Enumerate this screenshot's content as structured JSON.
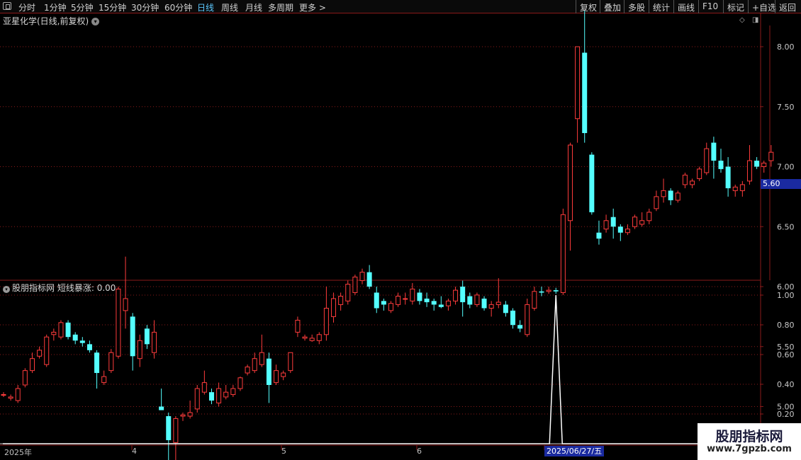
{
  "toolbar": {
    "periods": [
      "分时",
      "1分钟",
      "5分钟",
      "15分钟",
      "30分钟",
      "60分钟",
      "日线",
      "周线",
      "月线",
      "多周期",
      "更多 >"
    ],
    "active_period": "日线",
    "right_buttons": [
      "复权",
      "叠加",
      "多股",
      "统计",
      "画线",
      "F10",
      "标记",
      "+自选",
      "返回"
    ]
  },
  "chart_title": "亚星化学(日线,前复权)",
  "price_box": "5.60",
  "indicator": {
    "title": "股朋指标网",
    "label": "短线暴涨: 0.00"
  },
  "axis": {
    "price_ticks": [
      "8.00",
      "7.50",
      "7.00",
      "6.50",
      "6.00",
      "5.50",
      "5.00",
      "4.50"
    ],
    "indicator_ticks": [
      "1.00",
      "0.80",
      "0.60",
      "0.40",
      "0.20"
    ],
    "date_labels": [
      "2025年",
      "4",
      "5",
      "6"
    ],
    "cursor_date": "2025/06/27/五"
  },
  "watermark": {
    "title": "股朋指标网",
    "url": "www.7gpzb.com"
  },
  "colors": {
    "up": "#ff3c3c",
    "down": "#54ffff",
    "grid": "#8a1a1a",
    "price_box": "#1a2aa0"
  },
  "chart_data": {
    "type": "candlestick",
    "title": "亚星化学(日线,前复权)",
    "ylim": [
      4.3,
      8.4
    ],
    "candles": [
      [
        5.1,
        5.12,
        5.08,
        5.1
      ],
      [
        5.07,
        5.1,
        5.05,
        5.08
      ],
      [
        5.05,
        5.18,
        5.03,
        5.15
      ],
      [
        5.18,
        5.32,
        5.16,
        5.3
      ],
      [
        5.3,
        5.45,
        5.28,
        5.4
      ],
      [
        5.42,
        5.5,
        5.4,
        5.47
      ],
      [
        5.35,
        5.6,
        5.33,
        5.58
      ],
      [
        5.6,
        5.65,
        5.55,
        5.62
      ],
      [
        5.58,
        5.72,
        5.56,
        5.7
      ],
      [
        5.7,
        5.72,
        5.56,
        5.58
      ],
      [
        5.6,
        5.62,
        5.52,
        5.55
      ],
      [
        5.55,
        5.58,
        5.5,
        5.53
      ],
      [
        5.52,
        5.55,
        5.45,
        5.47
      ],
      [
        5.45,
        5.47,
        5.15,
        5.28
      ],
      [
        5.2,
        5.3,
        5.18,
        5.25
      ],
      [
        5.3,
        5.48,
        5.28,
        5.45
      ],
      [
        5.42,
        6.0,
        5.4,
        5.98
      ],
      [
        5.8,
        6.25,
        5.65,
        5.9
      ],
      [
        5.75,
        5.78,
        5.3,
        5.42
      ],
      [
        5.4,
        5.6,
        5.33,
        5.55
      ],
      [
        5.65,
        5.68,
        5.48,
        5.52
      ],
      [
        5.45,
        5.72,
        5.4,
        5.62
      ],
      [
        5.0,
        5.15,
        4.98,
        4.97
      ],
      [
        4.92,
        4.95,
        4.55,
        4.72
      ],
      [
        4.7,
        4.92,
        4.35,
        4.9
      ],
      [
        4.92,
        4.95,
        4.88,
        4.93
      ],
      [
        4.92,
        5.05,
        4.9,
        4.95
      ],
      [
        4.98,
        5.18,
        4.95,
        5.15
      ],
      [
        5.12,
        5.3,
        5.1,
        5.2
      ],
      [
        5.12,
        5.15,
        5.02,
        5.05
      ],
      [
        5.03,
        5.2,
        5.0,
        5.15
      ],
      [
        5.08,
        5.18,
        5.06,
        5.12
      ],
      [
        5.1,
        5.18,
        5.08,
        5.15
      ],
      [
        5.15,
        5.25,
        5.13,
        5.24
      ],
      [
        5.28,
        5.35,
        5.26,
        5.33
      ],
      [
        5.3,
        5.45,
        5.28,
        5.4
      ],
      [
        5.35,
        5.6,
        5.33,
        5.45
      ],
      [
        5.4,
        5.45,
        5.03,
        5.18
      ],
      [
        5.2,
        5.35,
        5.18,
        5.3
      ],
      [
        5.25,
        5.3,
        5.22,
        5.28
      ],
      [
        5.3,
        5.45,
        5.28,
        5.45
      ],
      [
        5.62,
        5.75,
        5.58,
        5.72
      ],
      [
        5.57,
        5.6,
        5.55,
        5.58
      ],
      [
        5.55,
        5.6,
        5.54,
        5.57
      ],
      [
        5.55,
        5.62,
        5.52,
        5.6
      ],
      [
        5.6,
        6.0,
        5.55,
        5.82
      ],
      [
        5.75,
        5.95,
        5.7,
        5.9
      ],
      [
        5.85,
        5.95,
        5.8,
        5.92
      ],
      [
        5.88,
        6.05,
        5.85,
        6.02
      ],
      [
        5.95,
        6.1,
        5.93,
        6.08
      ],
      [
        6.05,
        6.15,
        6.02,
        6.12
      ],
      [
        6.12,
        6.18,
        5.98,
        6.0
      ],
      [
        5.95,
        6.0,
        5.78,
        5.82
      ],
      [
        5.88,
        5.9,
        5.8,
        5.85
      ],
      [
        5.8,
        5.88,
        5.78,
        5.86
      ],
      [
        5.85,
        5.95,
        5.83,
        5.92
      ],
      [
        5.9,
        5.95,
        5.85,
        5.9
      ],
      [
        5.88,
        6.03,
        5.85,
        5.98
      ],
      [
        5.95,
        5.98,
        5.85,
        5.88
      ],
      [
        5.9,
        5.95,
        5.83,
        5.87
      ],
      [
        5.88,
        5.9,
        5.8,
        5.85
      ],
      [
        5.85,
        5.92,
        5.82,
        5.83
      ],
      [
        5.84,
        5.9,
        5.8,
        5.88
      ],
      [
        5.88,
        6.0,
        5.85,
        5.97
      ],
      [
        6.0,
        6.05,
        5.75,
        5.87
      ],
      [
        5.92,
        5.95,
        5.82,
        5.85
      ],
      [
        5.85,
        5.95,
        5.83,
        5.93
      ],
      [
        5.9,
        5.92,
        5.8,
        5.82
      ],
      [
        5.82,
        5.88,
        5.75,
        5.85
      ],
      [
        5.85,
        6.07,
        5.82,
        5.87
      ],
      [
        5.85,
        5.88,
        5.75,
        5.78
      ],
      [
        5.8,
        5.82,
        5.65,
        5.68
      ],
      [
        5.68,
        5.72,
        5.62,
        5.65
      ],
      [
        5.6,
        5.9,
        5.58,
        5.85
      ],
      [
        5.82,
        6.0,
        5.8,
        5.96
      ],
      [
        5.96,
        6.0,
        5.92,
        5.95
      ],
      [
        5.96,
        6.0,
        5.94,
        5.97
      ],
      [
        5.97,
        5.99,
        5.94,
        5.96
      ],
      [
        5.95,
        6.65,
        5.93,
        6.6
      ],
      [
        6.55,
        7.2,
        6.3,
        7.18
      ],
      [
        7.4,
        8.0,
        7.2,
        8.0
      ],
      [
        7.95,
        8.3,
        7.2,
        7.28
      ],
      [
        7.1,
        7.12,
        6.6,
        6.62
      ],
      [
        6.45,
        6.55,
        6.35,
        6.4
      ],
      [
        6.48,
        6.6,
        6.45,
        6.55
      ],
      [
        6.58,
        6.65,
        6.4,
        6.5
      ],
      [
        6.5,
        6.52,
        6.38,
        6.45
      ],
      [
        6.45,
        6.52,
        6.43,
        6.48
      ],
      [
        6.5,
        6.6,
        6.48,
        6.58
      ],
      [
        6.52,
        6.62,
        6.5,
        6.55
      ],
      [
        6.55,
        6.65,
        6.52,
        6.62
      ],
      [
        6.65,
        6.8,
        6.63,
        6.75
      ],
      [
        6.75,
        6.9,
        6.7,
        6.8
      ],
      [
        6.8,
        6.82,
        6.68,
        6.72
      ],
      [
        6.72,
        6.8,
        6.7,
        6.78
      ],
      [
        6.85,
        6.95,
        6.82,
        6.93
      ],
      [
        6.85,
        6.9,
        6.82,
        6.88
      ],
      [
        6.9,
        7.0,
        6.88,
        6.98
      ],
      [
        6.95,
        7.2,
        6.93,
        7.15
      ],
      [
        7.2,
        7.25,
        6.9,
        7.05
      ],
      [
        7.05,
        7.15,
        6.95,
        6.98
      ],
      [
        7.0,
        7.08,
        6.75,
        6.82
      ],
      [
        6.8,
        6.85,
        6.75,
        6.83
      ],
      [
        6.8,
        6.88,
        6.75,
        6.85
      ],
      [
        6.88,
        7.18,
        6.85,
        7.05
      ],
      [
        7.05,
        7.08,
        6.98,
        7.0
      ],
      [
        7.0,
        7.05,
        6.95,
        7.03
      ],
      [
        7.05,
        7.18,
        7.0,
        7.12
      ]
    ],
    "indicator_values_spike": {
      "index": 77,
      "value": 1.0
    }
  }
}
